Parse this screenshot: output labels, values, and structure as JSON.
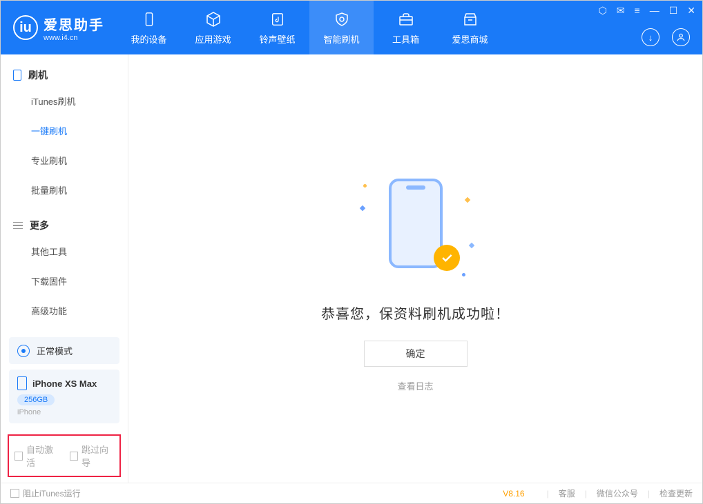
{
  "header": {
    "logo_title": "爱思助手",
    "logo_sub": "www.i4.cn",
    "nav": [
      {
        "label": "我的设备"
      },
      {
        "label": "应用游戏"
      },
      {
        "label": "铃声壁纸"
      },
      {
        "label": "智能刷机",
        "active": true
      },
      {
        "label": "工具箱"
      },
      {
        "label": "爱思商城"
      }
    ]
  },
  "sidebar": {
    "section1_title": "刷机",
    "section1_items": [
      {
        "label": "iTunes刷机"
      },
      {
        "label": "一键刷机",
        "active": true
      },
      {
        "label": "专业刷机"
      },
      {
        "label": "批量刷机"
      }
    ],
    "section2_title": "更多",
    "section2_items": [
      {
        "label": "其他工具"
      },
      {
        "label": "下载固件"
      },
      {
        "label": "高级功能"
      }
    ],
    "mode_label": "正常模式",
    "device_name": "iPhone XS Max",
    "device_storage": "256GB",
    "device_type": "iPhone",
    "check_auto_activate": "自动激活",
    "check_skip_guide": "跳过向导"
  },
  "main": {
    "success_text": "恭喜您，保资料刷机成功啦！",
    "ok_button": "确定",
    "view_log": "查看日志"
  },
  "footer": {
    "block_itunes": "阻止iTunes运行",
    "version": "V8.16",
    "link_service": "客服",
    "link_wechat": "微信公众号",
    "link_update": "检查更新"
  }
}
